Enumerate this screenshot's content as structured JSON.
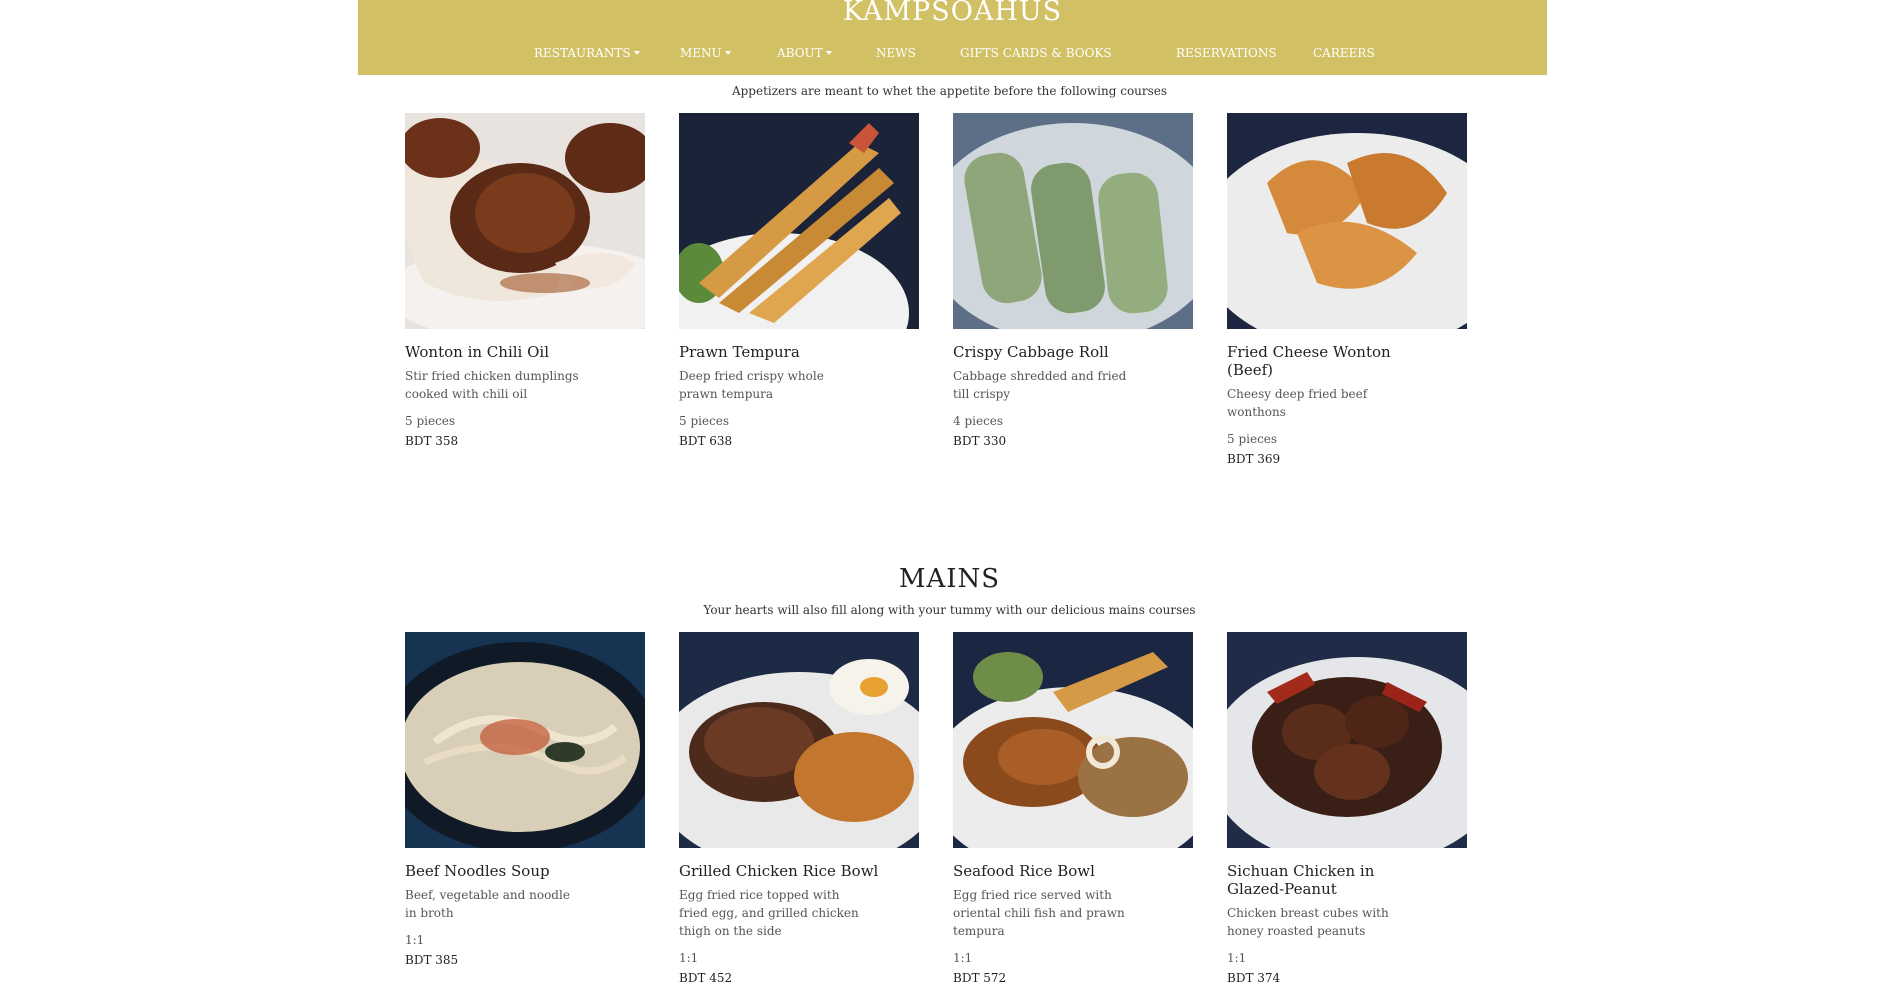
{
  "header": {
    "brand": "KAMPSOAHUS",
    "nav": [
      {
        "label": "RESTAURANTS",
        "dropdown": true
      },
      {
        "label": "MENU",
        "dropdown": true
      },
      {
        "label": "ABOUT",
        "dropdown": true
      },
      {
        "label": "NEWS",
        "dropdown": false
      },
      {
        "label": "GIFTS CARDS & BOOKS",
        "dropdown": false
      },
      {
        "label": "RESERVATIONS",
        "dropdown": false
      },
      {
        "label": "CAREERS",
        "dropdown": false
      }
    ]
  },
  "appetizers": {
    "subtitle": "Appetizers are meant to whet the appetite before the following courses",
    "items": [
      {
        "name": "Wonton in Chili Oil",
        "desc": "Stir fried chicken dumplings cooked with chili oil",
        "portion": "5 pieces",
        "price": "BDT 358"
      },
      {
        "name": "Prawn Tempura",
        "desc": "Deep fried crispy whole prawn tempura",
        "portion": "5 pieces",
        "price": "BDT 638"
      },
      {
        "name": "Crispy Cabbage Roll",
        "desc": "Cabbage shredded and fried till crispy",
        "portion": "4 pieces",
        "price": "BDT 330"
      },
      {
        "name": "Fried Cheese Wonton (Beef)",
        "desc": "Cheesy deep fried beef wonthons",
        "portion": "5 pieces",
        "price": "BDT 369"
      }
    ]
  },
  "mains": {
    "title": "MAINS",
    "subtitle": "Your hearts will also fill along with your tummy with our delicious mains courses",
    "items": [
      {
        "name": "Beef Noodles Soup",
        "desc": "Beef, vegetable and noodle in broth",
        "portion": "1:1",
        "price": "BDT 385"
      },
      {
        "name": "Grilled Chicken Rice Bowl",
        "desc": "Egg fried rice topped with fried egg, and grilled chicken thigh on the side",
        "portion": "1:1",
        "price": "BDT 452"
      },
      {
        "name": "Seafood Rice Bowl",
        "desc": "Egg fried rice served with oriental chili fish and prawn tempura",
        "portion": "1:1",
        "price": "BDT 572"
      },
      {
        "name": "Sichuan Chicken in Glazed-Peanut",
        "desc": "Chicken breast cubes with honey roasted peanuts",
        "portion": "1:1",
        "price": "BDT 374"
      }
    ]
  }
}
